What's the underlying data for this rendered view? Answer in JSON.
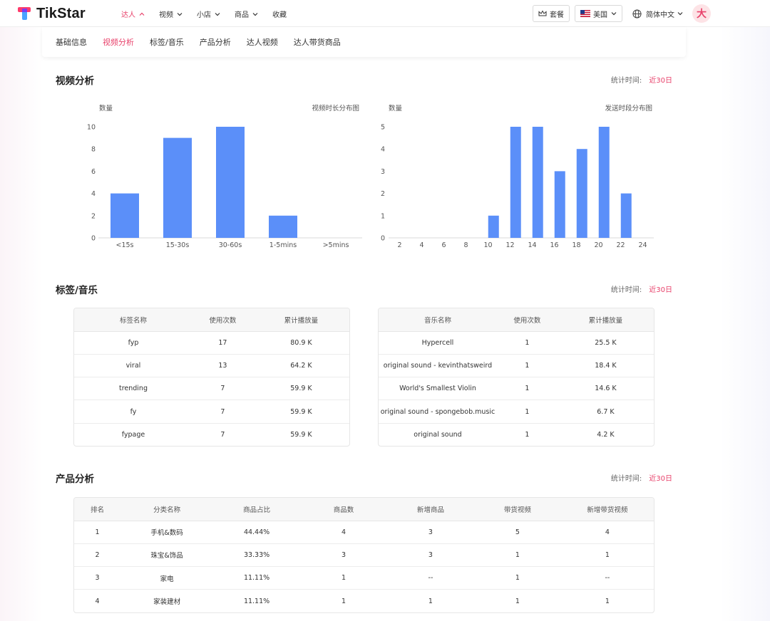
{
  "brand": {
    "name": "TikStar",
    "accent": "#e8426b",
    "bar_color": "#5b8ff9"
  },
  "nav": {
    "items": [
      {
        "label": "达人",
        "has_menu": true,
        "active": true
      },
      {
        "label": "视频",
        "has_menu": true,
        "active": false
      },
      {
        "label": "小店",
        "has_menu": true,
        "active": false
      },
      {
        "label": "商品",
        "has_menu": true,
        "active": false
      },
      {
        "label": "收藏",
        "has_menu": false,
        "active": false
      }
    ],
    "plan_label": "套餐",
    "region_label": "美国",
    "language_label": "简体中文",
    "avatar_text": "大"
  },
  "subtabs": [
    {
      "label": "基础信息",
      "active": false
    },
    {
      "label": "视频分析",
      "active": true
    },
    {
      "label": "标签/音乐",
      "active": false
    },
    {
      "label": "产品分析",
      "active": false
    },
    {
      "label": "达人视频",
      "active": false
    },
    {
      "label": "达人带货商品",
      "active": false
    }
  ],
  "video_section": {
    "title": "视频分析",
    "stat_label": "统计时间:",
    "stat_range": "近30日"
  },
  "chart_data": [
    {
      "type": "bar",
      "title": "视频时长分布图",
      "ylabel": "数量",
      "xlabel": "",
      "categories": [
        "<15s",
        "15-30s",
        "30-60s",
        "1-5mins",
        ">5mins"
      ],
      "values": [
        4,
        9,
        10,
        2,
        0
      ],
      "ylim": [
        0,
        10
      ],
      "yticks": [
        0,
        2,
        4,
        6,
        8,
        10
      ],
      "grid": false,
      "color": "#5b8ff9"
    },
    {
      "type": "bar",
      "title": "发送时段分布图",
      "ylabel": "数量",
      "xlabel": "",
      "x": [
        1,
        2,
        3,
        4,
        5,
        6,
        7,
        8,
        9,
        10,
        11,
        12,
        13,
        14,
        15,
        16,
        17,
        18,
        19,
        20,
        21,
        22,
        23,
        24
      ],
      "values": [
        0,
        0,
        0,
        0,
        0,
        0,
        0,
        0,
        0,
        1,
        0,
        5,
        0,
        5,
        0,
        3,
        0,
        4,
        0,
        5,
        0,
        2,
        0,
        0
      ],
      "xticks": [
        2,
        4,
        6,
        8,
        10,
        12,
        14,
        16,
        18,
        20,
        22,
        24
      ],
      "ylim": [
        0,
        5
      ],
      "yticks": [
        0,
        1,
        2,
        3,
        4,
        5
      ],
      "grid": false,
      "color": "#5b8ff9"
    }
  ],
  "tags_section": {
    "title": "标签/音乐",
    "stat_label": "统计时间:",
    "stat_range": "近30日",
    "tags_table": {
      "headers": [
        "标签名称",
        "使用次数",
        "累计播放量"
      ],
      "rows": [
        [
          "fyp",
          "17",
          "80.9 K"
        ],
        [
          "viral",
          "13",
          "64.2 K"
        ],
        [
          "trending",
          "7",
          "59.9 K"
        ],
        [
          "fy",
          "7",
          "59.9 K"
        ],
        [
          "fypage",
          "7",
          "59.9 K"
        ]
      ]
    },
    "music_table": {
      "headers": [
        "音乐名称",
        "使用次数",
        "累计播放量"
      ],
      "rows": [
        [
          "Hypercell",
          "1",
          "25.5 K"
        ],
        [
          "original sound - kevinthatsweird",
          "1",
          "18.4 K"
        ],
        [
          "World's Smallest Violin",
          "1",
          "14.6 K"
        ],
        [
          "original sound - spongebob.music",
          "1",
          "6.7 K"
        ],
        [
          "original sound",
          "1",
          "4.2 K"
        ]
      ]
    }
  },
  "product_section": {
    "title": "产品分析",
    "stat_label": "统计时间:",
    "stat_range": "近30日",
    "table": {
      "headers": [
        "排名",
        "分类名称",
        "商品占比",
        "商品数",
        "新增商品",
        "带货视频",
        "新增带货视频"
      ],
      "rows": [
        [
          "1",
          "手机&数码",
          "44.44%",
          "4",
          "3",
          "5",
          "4"
        ],
        [
          "2",
          "珠宝&饰品",
          "33.33%",
          "3",
          "3",
          "1",
          "1"
        ],
        [
          "3",
          "家电",
          "11.11%",
          "1",
          "--",
          "1",
          "--"
        ],
        [
          "4",
          "家装建材",
          "11.11%",
          "1",
          "1",
          "1",
          "1"
        ]
      ]
    }
  }
}
